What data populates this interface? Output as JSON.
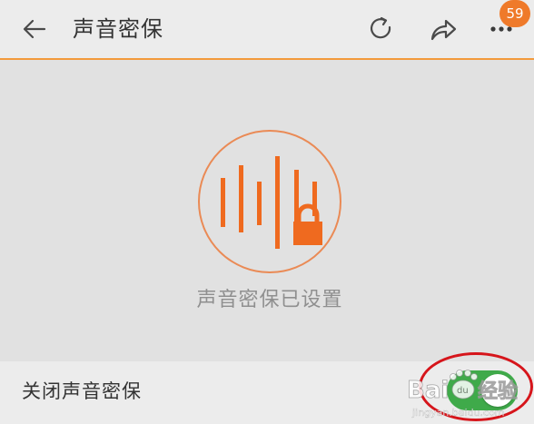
{
  "header": {
    "title": "声音密保",
    "back_icon": "arrow-left-icon",
    "refresh_icon": "refresh-icon",
    "share_icon": "share-icon",
    "more_icon": "more-dots-icon",
    "notification_count": "59",
    "accent_color": "#f39a3c"
  },
  "status": {
    "icon": "voice-lock-icon",
    "text": "声音密保已设置",
    "icon_color": "#ef6a1f"
  },
  "setting": {
    "label": "关闭声音密保",
    "toggle_on": true,
    "toggle_color": "#3faa4a"
  },
  "watermark": {
    "brand_text": "Baidu经验",
    "url_text": "jingyan.baidu.com"
  }
}
